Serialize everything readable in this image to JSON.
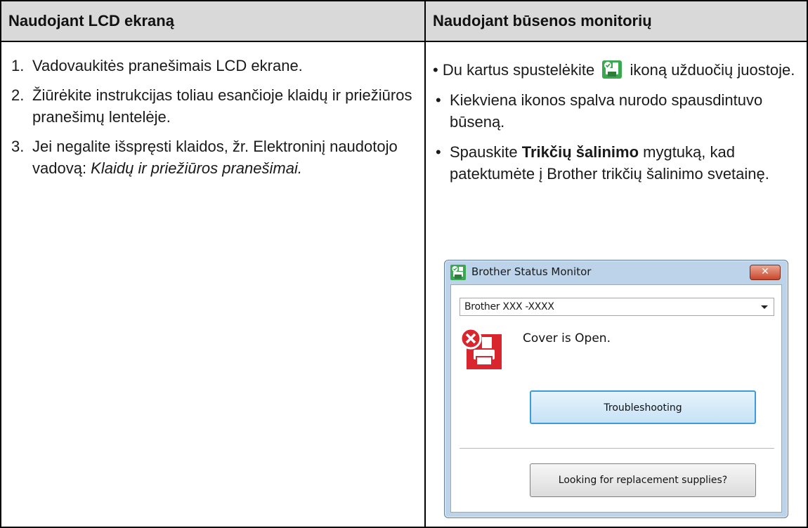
{
  "table": {
    "header_left": "Naudojant LCD ekraną",
    "header_right": "Naudojant būsenos monitorių"
  },
  "left": {
    "steps": [
      {
        "num": "1.",
        "text": "Vadovaukitės pranešimais LCD ekrane."
      },
      {
        "num": "2.",
        "text": "Žiūrėkite instrukcijas toliau esančioje klaidų ir priežiūros pranešimų lentelėje."
      },
      {
        "num": "3.",
        "text": "Jei negalite išspręsti klaidos, žr. Elektroninį naudotojo vadovą: ",
        "italic": "Klaidų ir priežiūros pranešimai."
      }
    ]
  },
  "right": {
    "bullet_char": "•",
    "b1_before": "Du kartus spustelėkite",
    "b1_after": "ikoną užduočių juostoje.",
    "b2": "Kiekviena ikonos spalva nurodo spausdintuvo būseną.",
    "b3_before": "Spauskite ",
    "b3_bold": "Trikčių šalinimo",
    "b3_after": " mygtuką, kad patektumėte į Brother trikčių šalinimo svetainę."
  },
  "dialog": {
    "title": "Brother Status Monitor",
    "close_label": "✕",
    "printer_select": "Brother XXX -XXXX",
    "status": "Cover is Open.",
    "troubleshooting_label": "Troubleshooting",
    "supplies_label": "Looking for replacement supplies?"
  },
  "icons": {
    "status_monitor": "status-monitor-icon",
    "error_printer": "printer-error-icon"
  },
  "colors": {
    "header_bg": "#d9d9d9",
    "icon_green": "#3aa84f",
    "error_red": "#d9262e",
    "accent_blue": "#3c9bd9"
  }
}
